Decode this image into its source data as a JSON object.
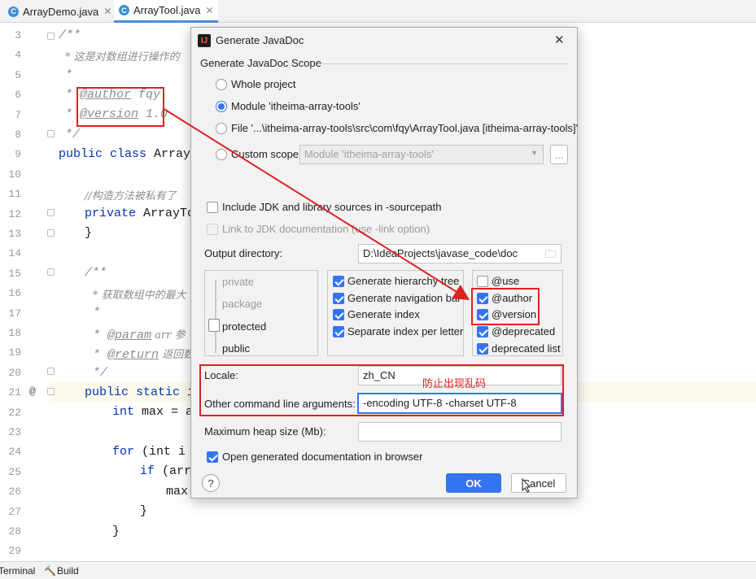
{
  "tabs": [
    {
      "label": "ArrayDemo.java",
      "icon": "java-class-icon"
    },
    {
      "label": "ArrayTool.java",
      "icon": "java-class-icon"
    }
  ],
  "editor": {
    "line_numbers": [
      "3",
      "4",
      "5",
      "6",
      "7",
      "8",
      "9",
      "10",
      "11",
      "12",
      "13",
      "14",
      "15",
      "16",
      "17",
      "18",
      "19",
      "20",
      "21",
      "22",
      "23",
      "24",
      "25",
      "26",
      "27",
      "28",
      "29"
    ],
    "gutter_marker": "@",
    "lines": {
      "l3": "/**",
      "l4": "* 这是对数组进行操作的",
      "l5": "*",
      "l6_tag": "@author",
      "l6_val": " fqy",
      "l7_tag": "@version",
      "l7_val": " 1.0",
      "l8": "*/",
      "l9_kw": "public class",
      "l9_name": " ArrayToo",
      "l11": "//构造方法被私有了",
      "l12_kw": "private",
      "l12_name": " ArrayToo",
      "l13": "}",
      "l15": "/**",
      "l16": "* 获取数组中的最大",
      "l17": "*",
      "l18_tag": "@param",
      "l18_val": " arr 参",
      "l19_tag": "@return",
      "l19_val": " 返回数",
      "l20": "*/",
      "l21_kw": "public static",
      "l21_rest": " in",
      "l22_kw": "int",
      "l22_rest": " max = ar",
      "l24_kw": "for",
      "l24_rest": " (int i =",
      "l25_kw": "if",
      "l25_rest": " (arr[",
      "l26": "max",
      "l27": "}",
      "l28": "}"
    }
  },
  "bottom": {
    "terminal": "Terminal",
    "build": "Build"
  },
  "dialog": {
    "title": "Generate JavaDoc",
    "scope_label": "Generate JavaDoc Scope",
    "scope_options": [
      "Whole project",
      "Module 'itheima-array-tools'",
      "File '...\\itheima-array-tools\\src\\com\\fqy\\ArrayTool.java [itheima-array-tools]'",
      "Custom scope"
    ],
    "custom_scope_value": "Module 'itheima-array-tools'",
    "include_jdk": "Include JDK and library sources in -sourcepath",
    "link_jdk": "Link to JDK documentation (use -link option)",
    "output_dir_label": "Output directory:",
    "output_dir_value": "D:\\IdeaProjects\\javase_code\\doc",
    "visibility_levels": [
      "private",
      "package",
      "protected",
      "public"
    ],
    "middle_options": [
      "Generate hierarchy tree",
      "Generate navigation bar",
      "Generate index",
      "Separate index per letter"
    ],
    "tag_options": [
      "@use",
      "@author",
      "@version",
      "@deprecated",
      "deprecated list"
    ],
    "locale_label": "Locale:",
    "locale_value": "zh_CN",
    "annotation": "防止出现乱码",
    "args_label": "Other command line arguments:",
    "args_value": "-encoding UTF-8 -charset UTF-8",
    "heap_label": "Maximum heap size (Mb):",
    "heap_value": "",
    "open_browser": "Open generated documentation in browser",
    "ok": "OK",
    "cancel": "Cancel",
    "help": "?",
    "browse": "...",
    "close": "✕"
  },
  "colors": {
    "accent": "#3574f0",
    "annotation_red": "#e02020"
  }
}
